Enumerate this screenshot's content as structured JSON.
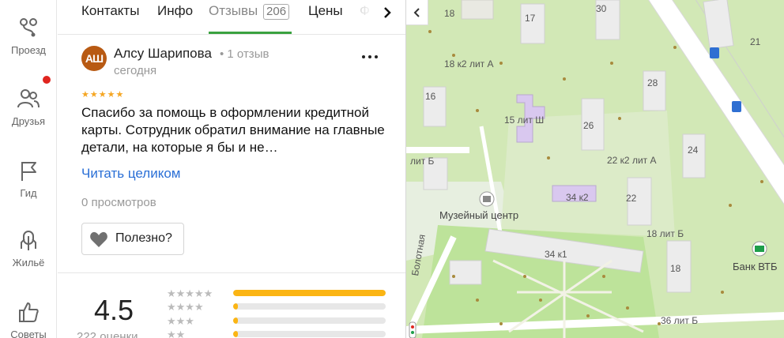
{
  "nav": {
    "items": [
      {
        "label": "Проезд",
        "icon": "route-icon"
      },
      {
        "label": "Друзья",
        "icon": "friends-icon"
      },
      {
        "label": "Гид",
        "icon": "flag-icon"
      },
      {
        "label": "Жильё",
        "icon": "housing-icon"
      },
      {
        "label": "Советы",
        "icon": "thumbs-up-icon"
      }
    ]
  },
  "tabs": {
    "items": [
      "Контакты",
      "Инфо",
      "Отзывы",
      "Цены",
      "Ф"
    ],
    "reviews_count": "206",
    "active": "Отзывы"
  },
  "review": {
    "avatar_initials": "АШ",
    "author": "Алсу Шарипова",
    "author_reviews": "• 1 отзыв",
    "date": "сегодня",
    "stars": "★★★★★",
    "text": "Спасибо за помощь в оформлении кредитной карты. Сотрудник обратил внимание на главные детали, на которые я бы и не…",
    "read_more": "Читать целиком",
    "views": "0 просмотров",
    "useful_label": "Полезно?"
  },
  "rating": {
    "value": "4.5",
    "count_text": "222 оценки",
    "distribution": [
      {
        "stars": "★★★★★",
        "fraction": 1.0
      },
      {
        "stars": "★★★★",
        "fraction": 0.03
      },
      {
        "stars": "★★★",
        "fraction": 0.03
      },
      {
        "stars": "★★",
        "fraction": 0.03
      }
    ]
  },
  "colors": {
    "accent_green": "#3aa23f",
    "link_blue": "#2a6fd6",
    "star_yellow": "#fbb514",
    "avatar_bg": "#b85a13"
  },
  "map": {
    "labels": {
      "l18a": "18",
      "l17": "17",
      "l30": "30",
      "l21": "21",
      "l18k2": "18 к2 лит А",
      "l16": "16",
      "l15": "15 лит Ш",
      "l26": "26",
      "l28": "28",
      "l24": "24",
      "llitb": "лит Б",
      "l22k2": "22 к2 лит А",
      "l34k2": "34 к2",
      "l22": "22",
      "museum": "Музейный центр",
      "l18litb": "18 лит Б",
      "l34k1": "34 к1",
      "l18": "18",
      "bank": "Банк ВТБ",
      "street": "Болотная",
      "l36litb": "36 лит Б"
    }
  }
}
